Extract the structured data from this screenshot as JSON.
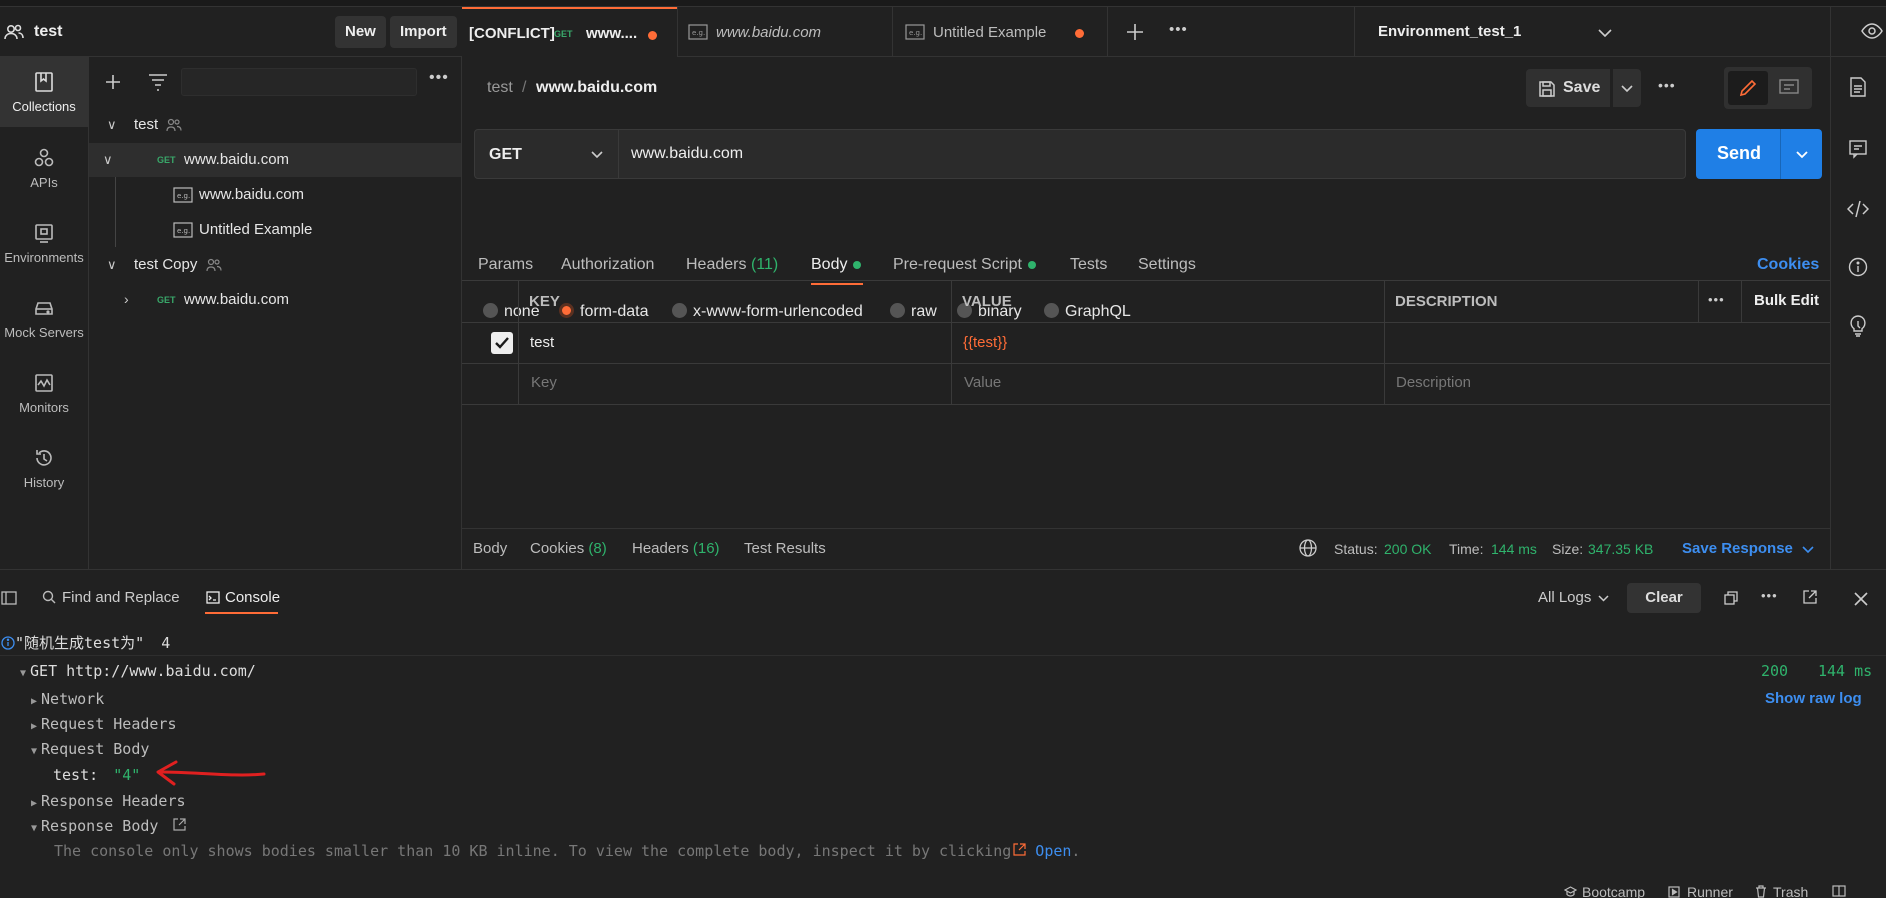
{
  "workspace": {
    "name": "test",
    "new_label": "New",
    "import_label": "Import"
  },
  "nav": [
    {
      "label": "Collections",
      "icon": "collections-icon"
    },
    {
      "label": "APIs",
      "icon": "apis-icon"
    },
    {
      "label": "Environments",
      "icon": "environments-icon"
    },
    {
      "label": "Mock Servers",
      "icon": "mock-servers-icon"
    },
    {
      "label": "Monitors",
      "icon": "monitors-icon"
    },
    {
      "label": "History",
      "icon": "history-icon"
    }
  ],
  "tree": {
    "root1": "test",
    "req1_method": "GET",
    "req1_name": "www.baidu.com",
    "ex1": "www.baidu.com",
    "ex2": "Untitled Example",
    "root2": "test Copy",
    "req2_method": "GET",
    "req2_name": "www.baidu.com"
  },
  "tabs": {
    "tab1_prefix": "[CONFLICT]",
    "tab1_method": "GET",
    "tab1_title": "www....",
    "tab2_title": "www.baidu.com",
    "tab3_title": "Untitled Example",
    "environment": "Environment_test_1"
  },
  "request": {
    "breadcrumb_root": "test",
    "breadcrumb_sep": "/",
    "breadcrumb_name": "www.baidu.com",
    "save_label": "Save",
    "method": "GET",
    "url": "www.baidu.com",
    "send_label": "Send",
    "subtabs": {
      "params": "Params",
      "authorization": "Authorization",
      "headers": "Headers",
      "headers_count": "(11)",
      "body": "Body",
      "prerequest": "Pre-request Script",
      "tests": "Tests",
      "settings": "Settings",
      "cookies": "Cookies"
    },
    "body_modes": [
      "none",
      "form-data",
      "x-www-form-urlencoded",
      "raw",
      "binary",
      "GraphQL"
    ],
    "table": {
      "key_header": "KEY",
      "value_header": "VALUE",
      "description_header": "DESCRIPTION",
      "bulk_edit": "Bulk Edit",
      "row_key": "test",
      "row_value": "{{test}}",
      "placeholder_key": "Key",
      "placeholder_value": "Value",
      "placeholder_description": "Description"
    }
  },
  "response": {
    "body": "Body",
    "cookies": "Cookies",
    "cookies_count": "(8)",
    "headers": "Headers",
    "headers_count": "(16)",
    "test_results": "Test Results",
    "status_label": "Status:",
    "status_value": "200 OK",
    "time_label": "Time:",
    "time_value": "144 ms",
    "size_label": "Size:",
    "size_value": "347.35 KB",
    "save_response": "Save Response"
  },
  "console": {
    "find_replace": "Find and Replace",
    "console_tab": "Console",
    "all_logs": "All Logs",
    "clear": "Clear",
    "log_text": "\"随机生成test为\"",
    "log_value": "4",
    "request_line": "GET http://www.baidu.com/",
    "status_code": "200",
    "duration": "144 ms",
    "show_raw_log": "Show raw log",
    "network": "Network",
    "request_headers": "Request Headers",
    "request_body": "Request Body",
    "body_key": "test:",
    "body_value": "\"4\"",
    "response_headers": "Response Headers",
    "response_body": "Response Body",
    "notice": "The console only shows bodies smaller than 10 KB inline. To view the complete body, inspect it by clicking",
    "open_link": "Open",
    "notice_end": "."
  },
  "footer": {
    "bootcamp": "Bootcamp",
    "runner": "Runner",
    "trash": "Trash"
  },
  "colors": {
    "accent": "#ff6c37",
    "send": "#1f7fe6",
    "green": "#2fb36c",
    "link": "#3d8ef0"
  }
}
